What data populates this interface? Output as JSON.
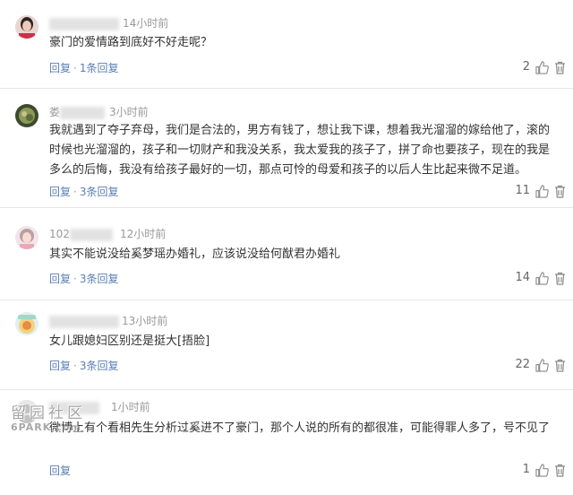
{
  "comments": [
    {
      "username_visible": "",
      "time": "14小时前",
      "text": "豪门的爱情路到底好不好走呢？",
      "reply_label": "回复",
      "replies_label": "1条回复",
      "likes": "2"
    },
    {
      "username_visible": "娄",
      "time": "3小时前",
      "text": "我就遇到了夺子弃母，我们是合法的，男方有钱了，想让我下课，想着我光溜溜的嫁给他了，滚的时候也光溜溜的，孩子和一切财产和我没关系，我太爱我的孩子了，拼了命也要孩子，现在的我是多么的后悔，我没有给孩子最好的一切，那点可怜的母爱和孩子的以后人生比起来微不足道。",
      "reply_label": "回复",
      "replies_label": "3条回复",
      "likes": "11"
    },
    {
      "username_visible": "102",
      "time": "12小时前",
      "text": "其实不能说没给奚梦瑶办婚礼，应该说没给何猷君办婚礼",
      "reply_label": "回复",
      "replies_label": "3条回复",
      "likes": "14"
    },
    {
      "username_visible": "",
      "time": "13小时前",
      "text": "女儿跟媳妇区别还是挺大[捂脸]",
      "reply_label": "回复",
      "replies_label": "3条回复",
      "likes": "22"
    },
    {
      "username_visible": "",
      "time": "1小时前",
      "text": "微博上有个看相先生分析过奚进不了豪门，那个人说的所有的都很准，可能得罪人多了，号不见了",
      "reply_label": "回复",
      "replies_label": "",
      "likes": "1"
    }
  ],
  "watermark": {
    "cn": "留园社区",
    "en": "6PARK.com"
  },
  "colors": {
    "link": "#5a7fb6",
    "muted": "#999999",
    "text": "#333333",
    "divider": "#e6e6e6"
  },
  "icons": {
    "like": "thumbs-up-icon",
    "delete": "trash-icon"
  }
}
